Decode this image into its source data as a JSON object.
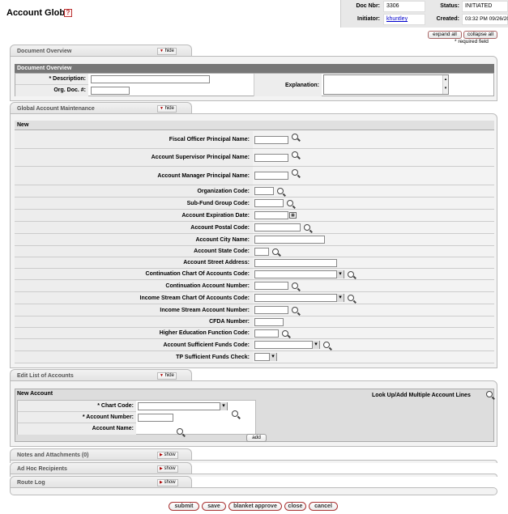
{
  "header": {
    "title": "Account Global",
    "help": "?",
    "doc_nbr_label": "Doc Nbr:",
    "doc_nbr": "3306",
    "status_label": "Status:",
    "status": "INITIATED",
    "initiator_label": "Initiator:",
    "initiator": "khuntley",
    "created_label": "Created:",
    "created": "03:32 PM 09/26/2009"
  },
  "controls": {
    "expand_all": "expand all",
    "collapse_all": "collapse all",
    "required_note": "* required field"
  },
  "tabs": {
    "doc_overview": {
      "label": "Document Overview",
      "button": "hide"
    },
    "gam": {
      "label": "Global Account Maintenance",
      "button": "hide"
    },
    "edit_list": {
      "label": "Edit List of Accounts",
      "button": "hide"
    },
    "notes": {
      "label": "Notes and Attachments (0)",
      "button": "show"
    },
    "adhoc": {
      "label": "Ad Hoc Recipients",
      "button": "show"
    },
    "routelog": {
      "label": "Route Log",
      "button": "show"
    }
  },
  "doc_overview": {
    "section_title": "Document Overview",
    "description_label": "* Description:",
    "orgdoc_label": "Org. Doc. #:",
    "explanation_label": "Explanation:"
  },
  "gam": {
    "section_title": "New",
    "fields": [
      {
        "label": "Fiscal Officer Principal Name:"
      },
      {
        "label": "Account Supervisor Principal Name:"
      },
      {
        "label": "Account Manager Principal Name:"
      },
      {
        "label": "Organization Code:"
      },
      {
        "label": "Sub-Fund Group Code:"
      },
      {
        "label": "Account Expiration Date:"
      },
      {
        "label": "Account Postal Code:"
      },
      {
        "label": "Account City Name:"
      },
      {
        "label": "Account State Code:"
      },
      {
        "label": "Account Street Address:"
      },
      {
        "label": "Continuation Chart Of Accounts Code:"
      },
      {
        "label": "Continuation Account Number:"
      },
      {
        "label": "Income Stream Chart Of Accounts Code:"
      },
      {
        "label": "Income Stream Account Number:"
      },
      {
        "label": "CFDA Number:"
      },
      {
        "label": "Higher Education Function Code:"
      },
      {
        "label": "Account Sufficient Funds Code:"
      },
      {
        "label": "TP Sufficient Funds Check:"
      }
    ]
  },
  "edit_list": {
    "section_title": "New Account",
    "lookup_label": "Look Up/Add Multiple Account Lines",
    "chart_label": "* Chart Code:",
    "account_label": "* Account Number:",
    "name_label": "Account Name:",
    "add_button": "add"
  },
  "actions": {
    "submit": "submit",
    "save": "save",
    "blanket_approve": "blanket approve",
    "close": "close",
    "cancel": "cancel"
  }
}
